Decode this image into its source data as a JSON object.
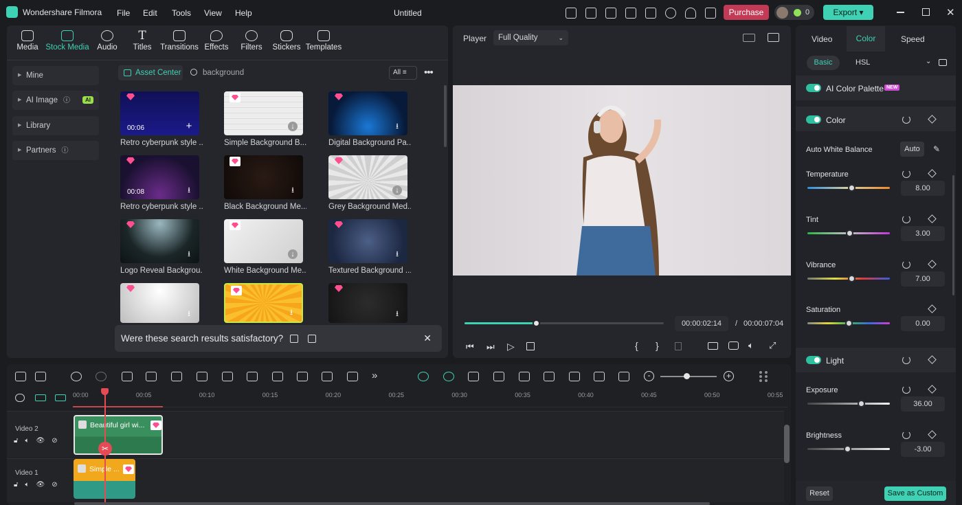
{
  "app": {
    "name": "Wondershare Filmora",
    "title": "Untitled",
    "menus": [
      "File",
      "Edit",
      "Tools",
      "View",
      "Help"
    ],
    "purchase": "Purchase",
    "credits": "0",
    "export": "Export"
  },
  "media_tabs": [
    {
      "label": "Media",
      "icon": "media-icon"
    },
    {
      "label": "Stock Media",
      "icon": "stock-media-icon",
      "active": true
    },
    {
      "label": "Audio",
      "icon": "audio-icon"
    },
    {
      "label": "Titles",
      "icon": "titles-icon"
    },
    {
      "label": "Transitions",
      "icon": "transitions-icon"
    },
    {
      "label": "Effects",
      "icon": "effects-icon"
    },
    {
      "label": "Filters",
      "icon": "filters-icon"
    },
    {
      "label": "Stickers",
      "icon": "stickers-icon"
    },
    {
      "label": "Templates",
      "icon": "templates-icon"
    }
  ],
  "sidebar": [
    {
      "label": "Mine"
    },
    {
      "label": "AI Image",
      "badge": "AI"
    },
    {
      "label": "Library"
    },
    {
      "label": "Partners"
    }
  ],
  "asset": {
    "center": "Asset Center",
    "search_value": "background",
    "filter": "All"
  },
  "thumbs": [
    {
      "label": "Retro cyberpunk style ...",
      "dur": "00:06"
    },
    {
      "label": "Simple Background B..."
    },
    {
      "label": "Digital Background Pa..."
    },
    {
      "label": "Retro cyberpunk style ...",
      "dur": "00:08"
    },
    {
      "label": "Black Background Me..."
    },
    {
      "label": "Grey Background Med..."
    },
    {
      "label": "Logo Reveal Backgrou..."
    },
    {
      "label": "White Background Me..."
    },
    {
      "label": "Textured Background ..."
    },
    {
      "label": ""
    },
    {
      "label": ""
    },
    {
      "label": ""
    }
  ],
  "feedback": "Were these search results satisfactory?",
  "player": {
    "label": "Player",
    "quality": "Full Quality",
    "current": "00:00:02:14",
    "sep": "/",
    "total": "00:00:07:04",
    "progress": 0.36
  },
  "right_tabs": [
    "Video",
    "Color",
    "Speed"
  ],
  "sub_tabs": [
    "Basic",
    "HSL"
  ],
  "ai_palette": "AI Color Palette",
  "new_badge": "NEW",
  "color_section": "Color",
  "awb": "Auto White Balance",
  "auto": "Auto",
  "params": [
    {
      "label": "Temperature",
      "value": "8.00",
      "pos": 0.53
    },
    {
      "label": "Tint",
      "value": "3.00",
      "pos": 0.51
    },
    {
      "label": "Vibrance",
      "value": "7.00",
      "pos": 0.53
    },
    {
      "label": "Saturation",
      "value": "0.00",
      "pos": 0.5
    }
  ],
  "light_section": "Light",
  "light_params": [
    {
      "label": "Exposure",
      "value": "36.00",
      "pos": 0.65
    },
    {
      "label": "Brightness",
      "value": "-3.00",
      "pos": 0.48
    }
  ],
  "reset": "Reset",
  "save_custom": "Save as Custom",
  "ruler": [
    "00:00",
    "00:05",
    "00:10",
    "00:15",
    "00:20",
    "00:25",
    "00:30",
    "00:35",
    "00:40",
    "00:45",
    "00:50",
    "00:55"
  ],
  "tracks": [
    {
      "name": "Video 2",
      "clip": "Beautiful girl wi..."
    },
    {
      "name": "Video 1",
      "clip": "Simple ..."
    }
  ]
}
